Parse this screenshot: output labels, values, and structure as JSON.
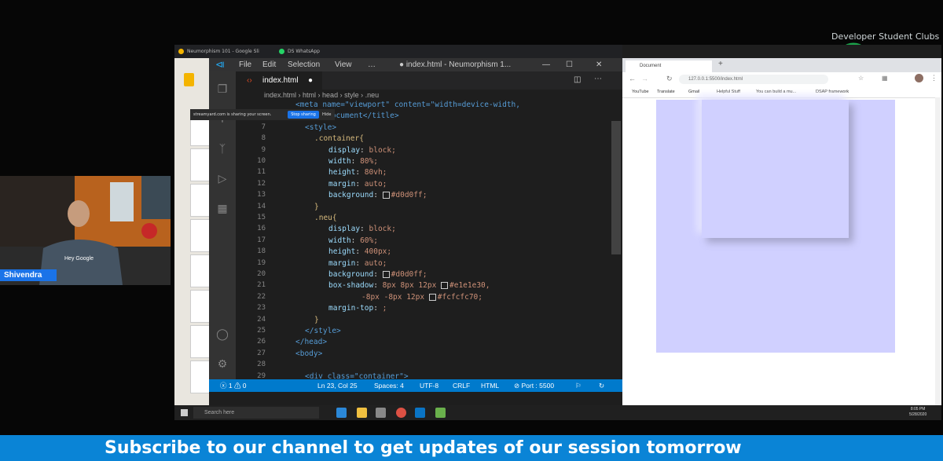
{
  "overlay": {
    "org_label": "Developer Student Clubs",
    "logo_text": "OMG",
    "presenter_name": "Shivendra",
    "shirt_text": "Hey Google",
    "banner_text": "Subscribe to our channel to get updates of our session tomorrow"
  },
  "chrome_tabs": [
    {
      "label": "Neumorphism 101 - Google Sli",
      "color": "#f4b400"
    },
    {
      "label": "DS WhatsApp",
      "color": "#25d366"
    }
  ],
  "share_toast": {
    "text": "streamyard.com is sharing your screen.",
    "button": "Stop sharing",
    "hide": "Hide"
  },
  "vscode": {
    "menu": [
      "File",
      "Edit",
      "Selection",
      "View",
      "…"
    ],
    "window_title": "● index.html - Neumorphism 1...",
    "tab_label": "index.html",
    "breadcrumb": [
      "index.html",
      "html",
      "head",
      "style",
      ".neu"
    ],
    "code_lines": [
      {
        "n": "",
        "t": "<meta name=\"viewport\" content=\"width=device-width,"
      },
      {
        "n": "6",
        "t": "<title>Document</title>"
      },
      {
        "n": "7",
        "t": "<style>"
      },
      {
        "n": "8",
        "t": ".container{"
      },
      {
        "n": "9",
        "t": "display: block;"
      },
      {
        "n": "10",
        "t": "width: 80%;"
      },
      {
        "n": "11",
        "t": "height: 80vh;"
      },
      {
        "n": "12",
        "t": "margin: auto;"
      },
      {
        "n": "13",
        "t": "background: #d0d0ff;"
      },
      {
        "n": "14",
        "t": "}"
      },
      {
        "n": "15",
        "t": ".neu{"
      },
      {
        "n": "16",
        "t": "display: block;"
      },
      {
        "n": "17",
        "t": "width: 60%;"
      },
      {
        "n": "18",
        "t": "height: 400px;"
      },
      {
        "n": "19",
        "t": "margin: auto;"
      },
      {
        "n": "20",
        "t": "background: #d0d0ff;"
      },
      {
        "n": "21",
        "t": "box-shadow: 8px 8px 12px #e1e1e30,"
      },
      {
        "n": "22",
        "t": "-8px -8px 12px #fcfcfc70;"
      },
      {
        "n": "23",
        "t": "margin-top: ;"
      },
      {
        "n": "24",
        "t": "}"
      },
      {
        "n": "25",
        "t": "</style>"
      },
      {
        "n": "26",
        "t": "</head>"
      },
      {
        "n": "27",
        "t": "<body>"
      },
      {
        "n": "28",
        "t": ""
      },
      {
        "n": "29",
        "t": "<div class=\"container\">"
      }
    ],
    "status": {
      "problems": "ⓧ 1 ⚠ 0",
      "position": "Ln 23, Col 25",
      "spaces": "Spaces: 4",
      "encoding": "UTF-8",
      "eol": "CRLF",
      "language": "HTML",
      "port": "⊘ Port : 5500"
    }
  },
  "browser": {
    "tab_title": "Document",
    "url": "127.0.0.1:5500/index.html",
    "bookmarks": [
      "YouTube",
      "Translate",
      "Gmail",
      "Helpful Stuff",
      "You can build a mu...",
      "DSAP framework"
    ],
    "container_color": "#d0d0ff"
  },
  "taskbar": {
    "search_placeholder": "Search here",
    "time": "8:05 PM",
    "date": "5/28/2020"
  }
}
